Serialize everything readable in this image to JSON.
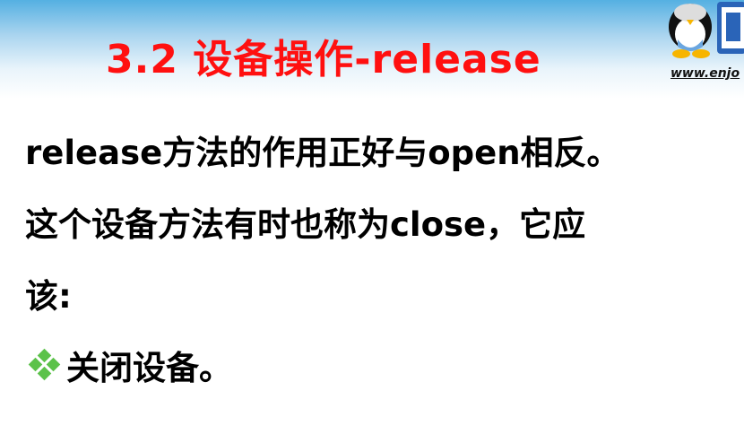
{
  "slide": {
    "title": "3.2 设备操作-release",
    "logo_url_text": "www.enjo",
    "body_lines": [
      "release方法的作用正好与open相反。",
      "这个设备方法有时也称为close，它应",
      "该:"
    ],
    "bullets": [
      {
        "text": "关闭设备。",
        "icon": "green-diamond-bullet-icon",
        "color": "#5cc24a"
      }
    ],
    "colors": {
      "title": "#ff1010",
      "header_gradient_top": "#55b0e2"
    }
  }
}
